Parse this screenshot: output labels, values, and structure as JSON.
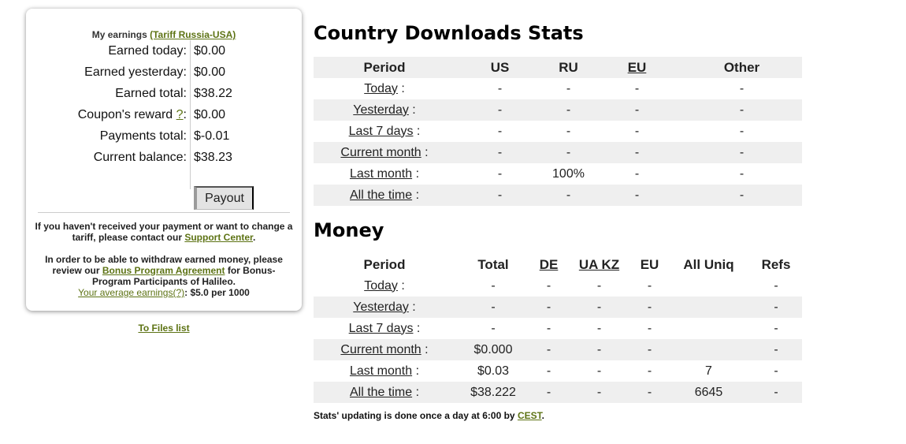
{
  "earnings": {
    "title": "My earnings",
    "tariff_link": "(Tariff Russia-USA)",
    "rows": [
      {
        "label": "Earned today:",
        "value": "$0.00"
      },
      {
        "label": "Earned yesterday:",
        "value": "$0.00"
      },
      {
        "label": "Earned total:",
        "value": "$38.22"
      },
      {
        "label": "Coupon's reward",
        "value": "$0.00"
      },
      {
        "label": "Payments total:",
        "value": "$-0.01"
      },
      {
        "label": "Current balance:",
        "value": "$38.23"
      }
    ],
    "coupon_help": "?",
    "coupon_colon": ":",
    "payout_label": "Payout",
    "note1_text": "If you haven't received your payment or want to change a tariff, please contact our",
    "note1_link": "Support Center",
    "note1_end": ".",
    "note2_text": "In order to be able to withdraw earned money, please review our",
    "note2_link": "Bonus Program Agreement",
    "note2_text2": "for Bonus-Program Participants of Halileo.",
    "avg_link": "Your average earnings(?)",
    "avg_value": ": $5.0 per 1000",
    "files_link": "To Files list"
  },
  "country_stats": {
    "title": "Country Downloads Stats",
    "headers": [
      "Period",
      "US",
      "RU",
      "EU",
      "Other"
    ],
    "rows": [
      {
        "period": "Today",
        "cells": [
          "-",
          "-",
          "-",
          "-"
        ]
      },
      {
        "period": "Yesterday",
        "cells": [
          "-",
          "-",
          "-",
          "-"
        ]
      },
      {
        "period": "Last 7 days",
        "cells": [
          "-",
          "-",
          "-",
          "-"
        ]
      },
      {
        "period": "Current month",
        "cells": [
          "-",
          "-",
          "-",
          "-"
        ]
      },
      {
        "period": "Last month",
        "cells": [
          "-",
          "100%",
          "-",
          "-"
        ]
      },
      {
        "period": "All the time",
        "cells": [
          "-",
          "-",
          "-",
          "-"
        ]
      }
    ]
  },
  "money_stats": {
    "title": "Money",
    "headers": [
      "Period",
      "Total",
      "DE",
      "UA KZ",
      "EU",
      "All Uniq",
      "Refs"
    ],
    "rows": [
      {
        "period": "Today",
        "cells": [
          "-",
          "-",
          "-",
          "-",
          "",
          "-"
        ]
      },
      {
        "period": "Yesterday",
        "cells": [
          "-",
          "-",
          "-",
          "-",
          "",
          "-"
        ]
      },
      {
        "period": "Last 7 days",
        "cells": [
          "-",
          "-",
          "-",
          "-",
          "",
          "-"
        ]
      },
      {
        "period": "Current month",
        "cells": [
          "$0.000",
          "-",
          "-",
          "-",
          "",
          "-"
        ]
      },
      {
        "period": "Last month",
        "cells": [
          "$0.03",
          "-",
          "-",
          "-",
          "7",
          "-"
        ]
      },
      {
        "period": "All the time",
        "cells": [
          "$38.222",
          "-",
          "-",
          "-",
          "6645",
          "-"
        ]
      }
    ]
  },
  "footnote": {
    "text": "Stats' updating is done once a day at 6:00 by",
    "link": "CEST",
    "end": "."
  },
  "colors": {
    "link_green": "#5d7314",
    "row_shade": "#efefef"
  }
}
